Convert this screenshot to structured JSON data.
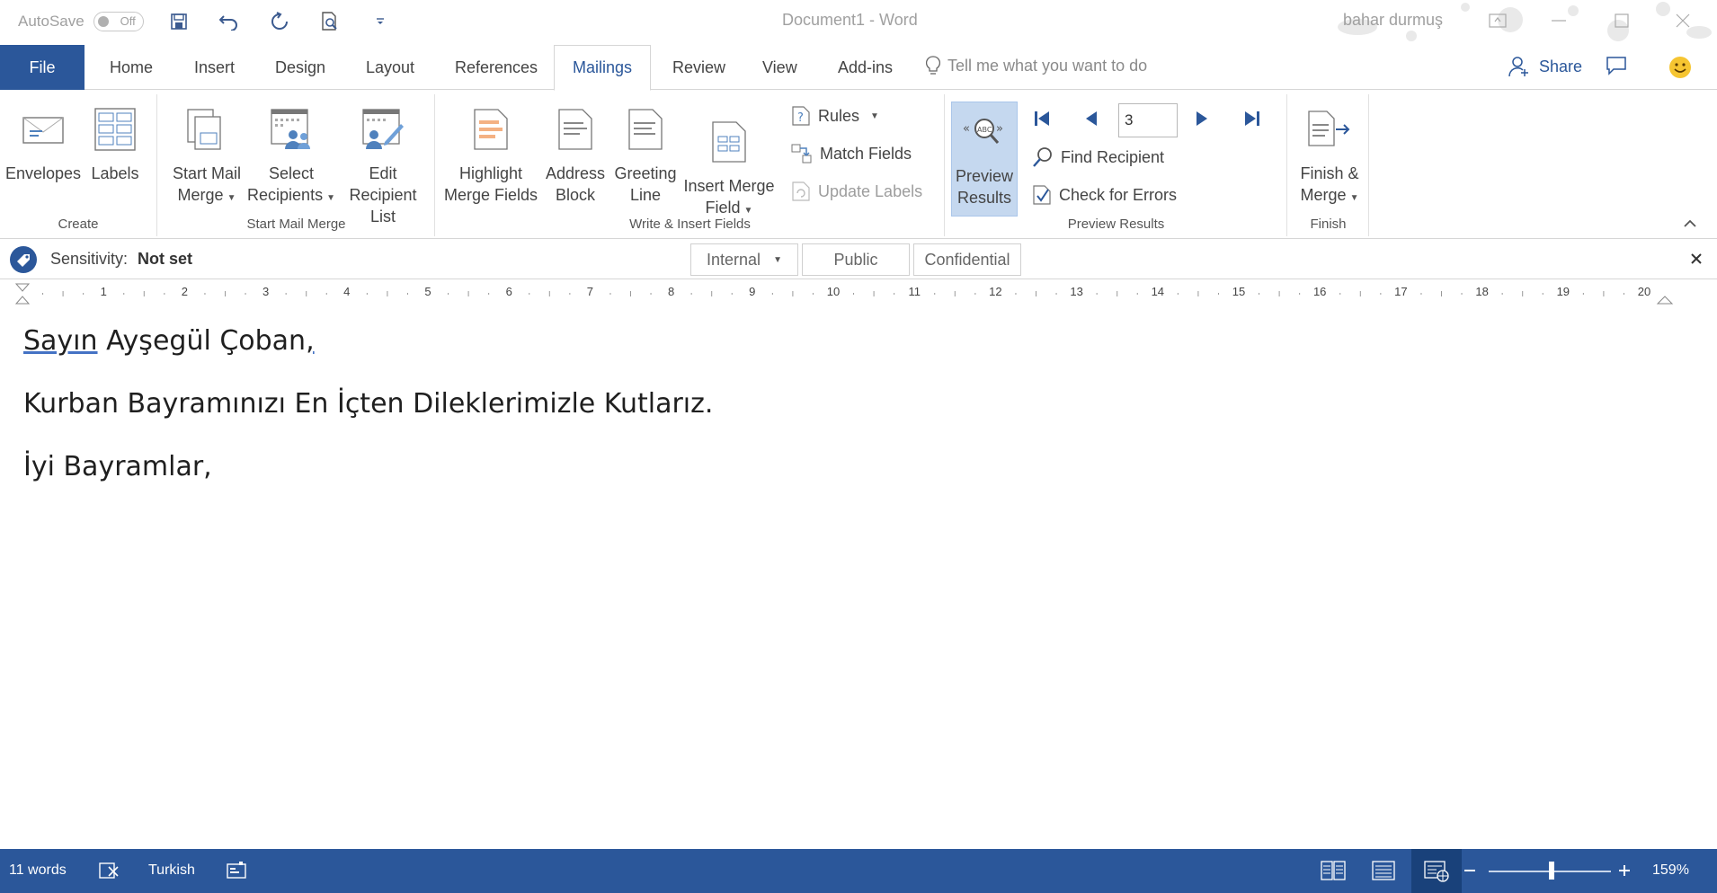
{
  "titlebar": {
    "autosave_label": "AutoSave",
    "autosave_state": "Off",
    "doc_title": "Document1  -  Word",
    "user_name": "bahar durmuş"
  },
  "tabs": {
    "file": "File",
    "home": "Home",
    "insert": "Insert",
    "design": "Design",
    "layout": "Layout",
    "references": "References",
    "mailings": "Mailings",
    "review": "Review",
    "view": "View",
    "addins": "Add-ins",
    "tell_me": "Tell me what you want to do",
    "share": "Share"
  },
  "ribbon": {
    "create": {
      "label": "Create",
      "envelopes": "Envelopes",
      "labels": "Labels"
    },
    "start": {
      "label": "Start Mail Merge",
      "start_mail_merge_1": "Start Mail",
      "start_mail_merge_2": "Merge",
      "select_recipients_1": "Select",
      "select_recipients_2": "Recipients",
      "edit_list_1": "Edit",
      "edit_list_2": "Recipient List"
    },
    "write": {
      "label": "Write & Insert Fields",
      "highlight_1": "Highlight",
      "highlight_2": "Merge Fields",
      "address_1": "Address",
      "address_2": "Block",
      "greeting_1": "Greeting",
      "greeting_2": "Line",
      "insert_field_1": "Insert Merge",
      "insert_field_2": "Field",
      "rules": "Rules",
      "match_fields": "Match Fields",
      "update_labels": "Update Labels"
    },
    "preview": {
      "label": "Preview Results",
      "preview_1": "Preview",
      "preview_2": "Results",
      "record": "3",
      "find_recipient": "Find Recipient",
      "check_errors": "Check for Errors"
    },
    "finish": {
      "label": "Finish",
      "finish_1": "Finish &",
      "finish_2": "Merge"
    }
  },
  "sensitivity": {
    "label": "Sensitivity:",
    "value": "Not set",
    "options": [
      "Internal",
      "Public",
      "Confidential"
    ]
  },
  "ruler": {
    "labels": [
      "1",
      "2",
      "3",
      "4",
      "5",
      "6",
      "7",
      "8",
      "9",
      "10",
      "11",
      "12",
      "13",
      "14",
      "15",
      "16",
      "17",
      "18",
      "19",
      "20"
    ]
  },
  "document": {
    "salutation_word": "Sayın",
    "salutation_name": " Ayşegül Çoban",
    "salutation_comma": ",",
    "line2": "Kurban Bayramınızı En İçten Dileklerimizle Kutlarız.",
    "line3": "İyi Bayramlar,"
  },
  "status": {
    "words": "11 words",
    "language": "Turkish",
    "zoom": "159%"
  },
  "colors": {
    "accent": "#2b579a",
    "pressed": "#c5d8ef"
  }
}
